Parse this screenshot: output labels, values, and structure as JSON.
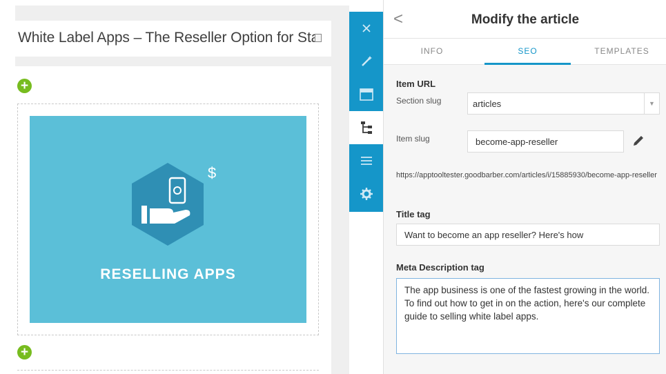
{
  "editor": {
    "article_title": "White Label Apps – The Reseller Option for Sta",
    "image_caption": "RESELLING APPS",
    "image_currency_symbol": "$"
  },
  "toolbar": {
    "items": [
      {
        "icon": "close-icon"
      },
      {
        "icon": "magic-wand-icon"
      },
      {
        "icon": "layout-icon"
      },
      {
        "icon": "tree-structure-icon",
        "active": true
      },
      {
        "icon": "list-icon"
      },
      {
        "icon": "gear-icon"
      }
    ]
  },
  "panel": {
    "back": "<",
    "title": "Modify the article",
    "tabs": [
      {
        "label": "INFO"
      },
      {
        "label": "SEO",
        "active": true
      },
      {
        "label": "TEMPLATES"
      }
    ],
    "item_url": {
      "heading": "Item URL",
      "section_slug_label": "Section slug",
      "section_slug_value": "articles",
      "item_slug_label": "Item slug",
      "item_slug_value": "become-app-reseller",
      "full_url": "https://apptooltester.goodbarber.com/articles/i/15885930/become-app-reseller"
    },
    "title_tag": {
      "heading": "Title tag",
      "value": "Want to become an app reseller? Here's how"
    },
    "meta_description": {
      "heading": "Meta Description tag",
      "value": "The app business is one of the fastest growing in the world. To find out how to get in on the action, here's our complete guide to selling white label apps."
    }
  },
  "colors": {
    "accent": "#1596c9",
    "add_button": "#77bc1f",
    "image_background": "#5bbfd8"
  }
}
